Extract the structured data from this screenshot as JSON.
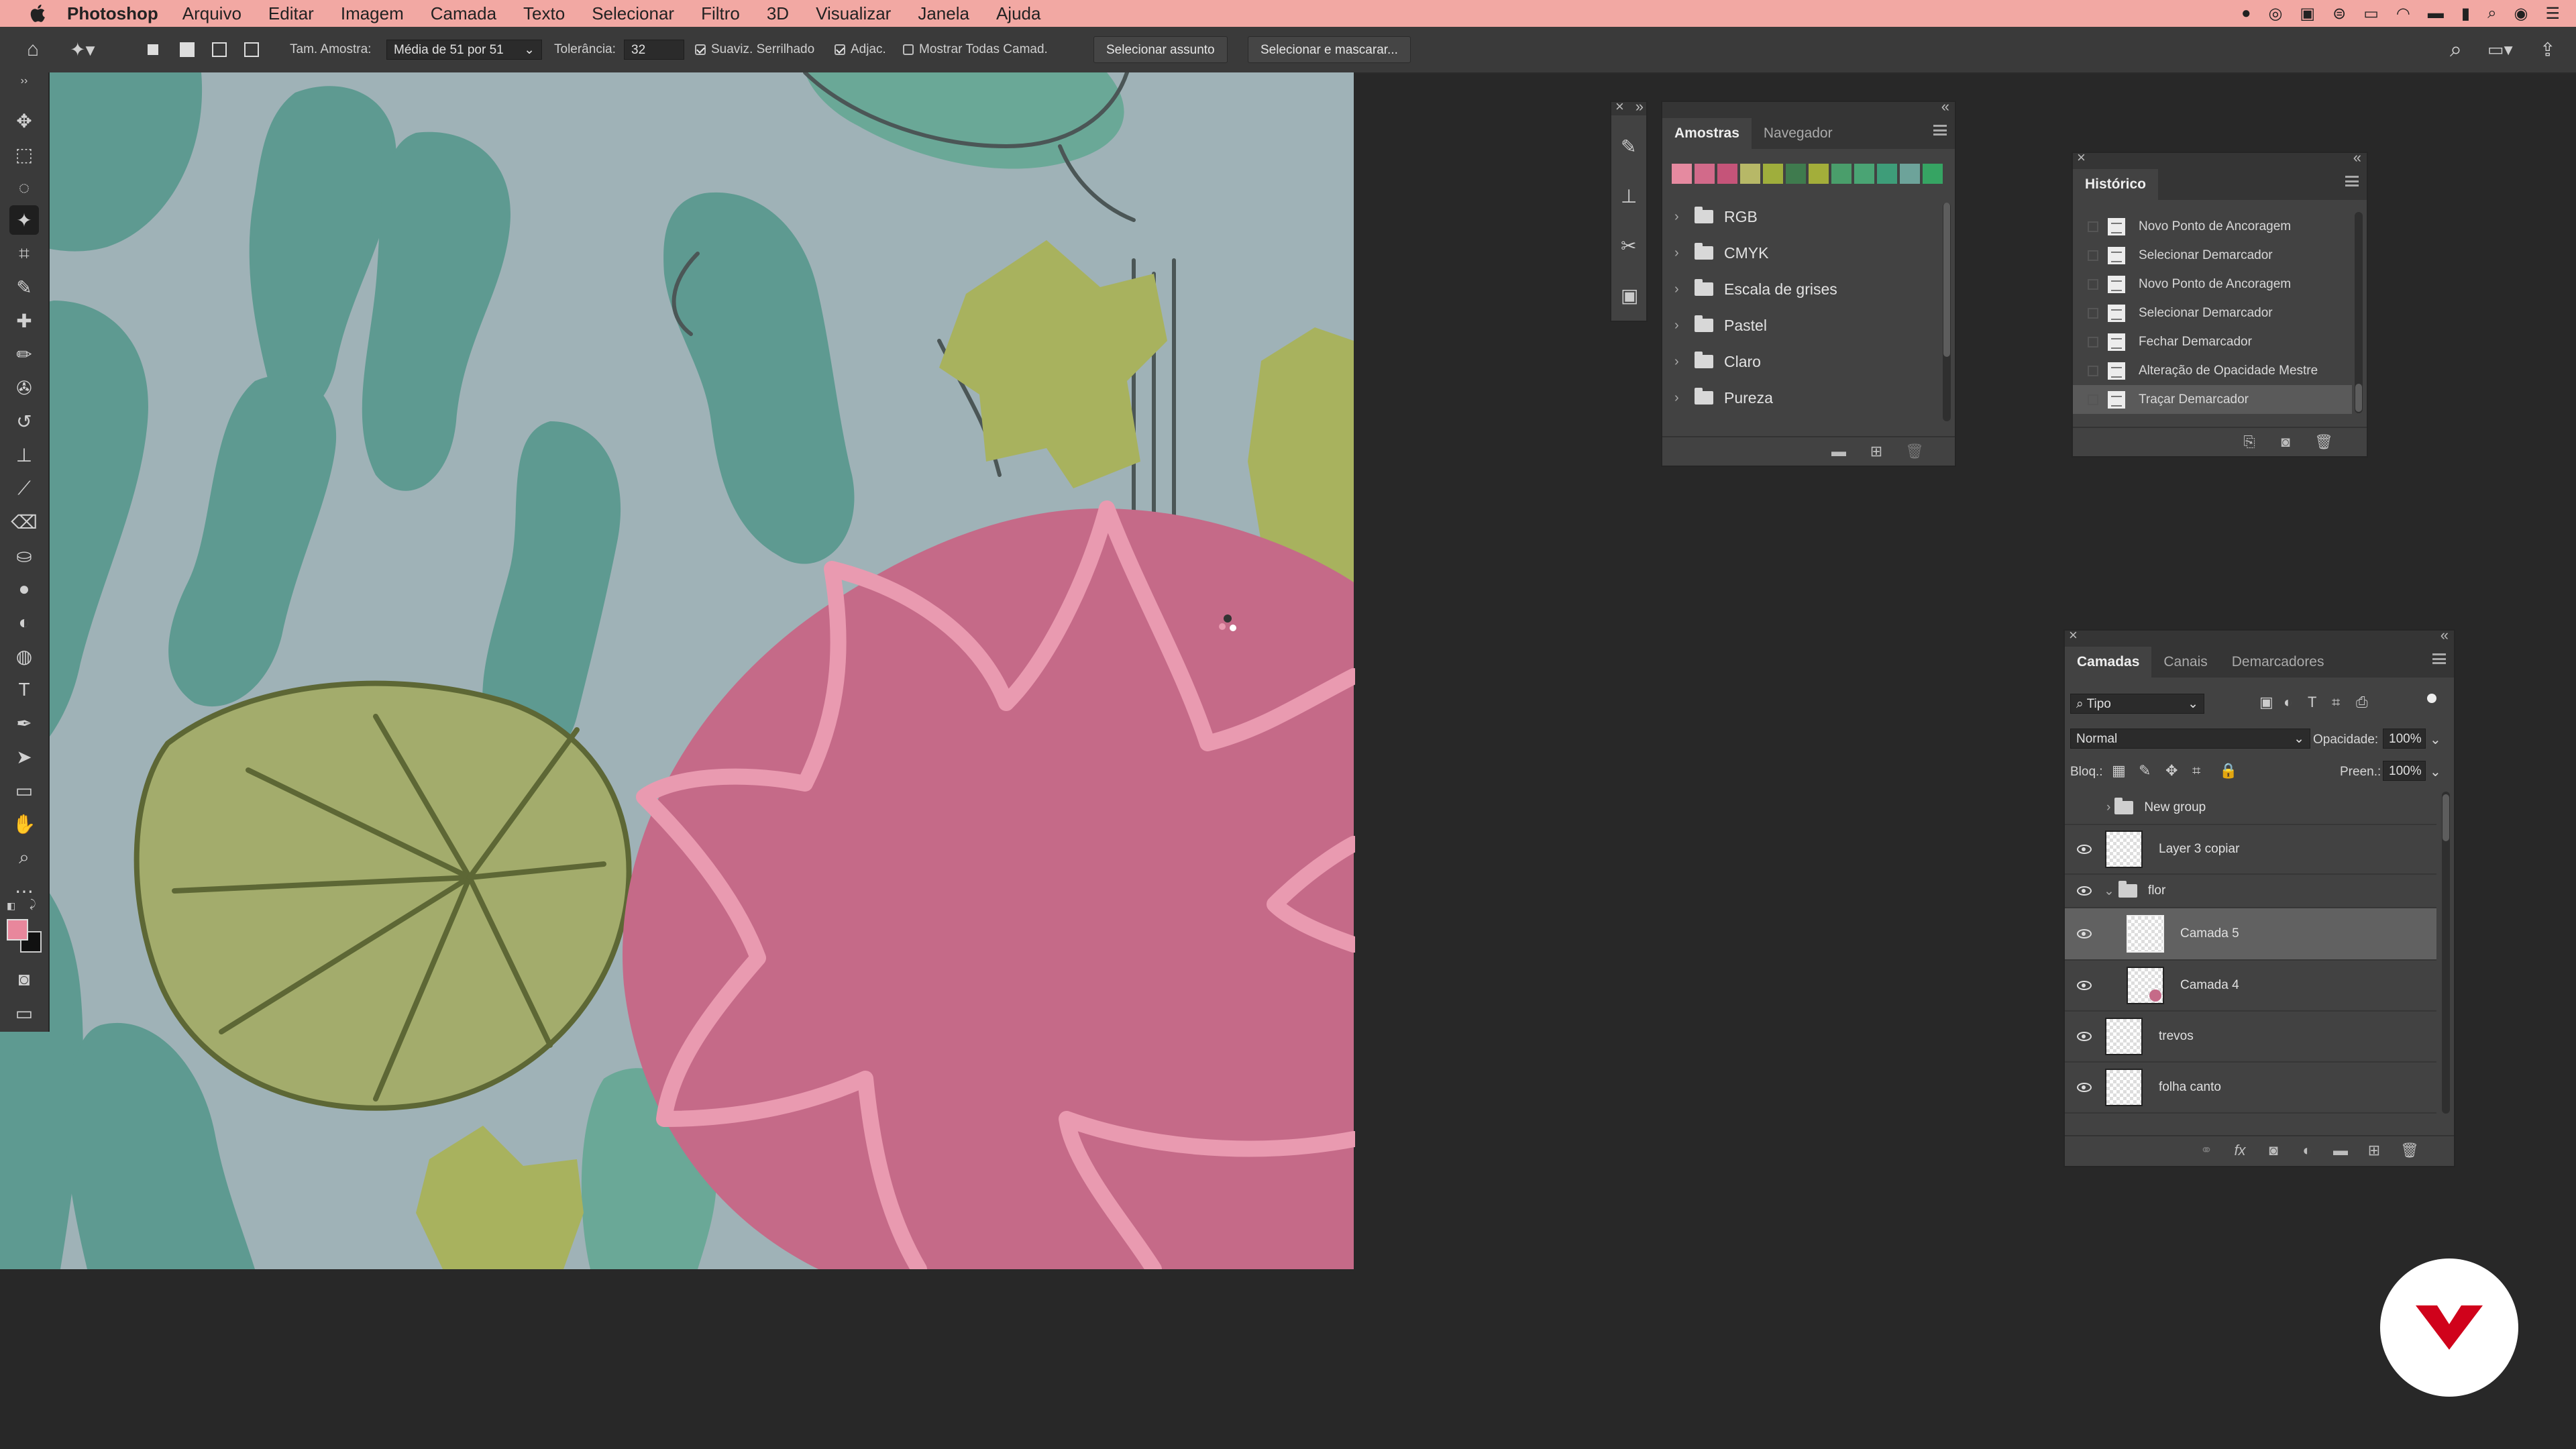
{
  "menubar": {
    "app": "Photoshop",
    "menus": [
      "Arquivo",
      "Editar",
      "Imagem",
      "Camada",
      "Texto",
      "Selecionar",
      "Filtro",
      "3D",
      "Visualizar",
      "Janela",
      "Ajuda"
    ]
  },
  "options": {
    "sample_size_label": "Tam. Amostra:",
    "sample_size_value": "Média de 51 por 51",
    "tolerance_label": "Tolerância:",
    "tolerance_value": "32",
    "antialias_label": "Suaviz. Serrilhado",
    "antialias_checked": true,
    "contiguous_label": "Adjac.",
    "contiguous_checked": true,
    "sample_all_label": "Mostrar Todas Camad.",
    "sample_all_checked": false,
    "select_subject": "Selecionar assunto",
    "select_mask": "Selecionar e mascarar..."
  },
  "colors": {
    "foreground": "#e8879c",
    "background": "#111111",
    "menubar_bg": "#f2a8a3"
  },
  "swatches_panel": {
    "tabs": [
      "Amostras",
      "Navegador"
    ],
    "active_tab": "Amostras",
    "swatches": [
      "#e58aa0",
      "#d26a8a",
      "#c55479",
      "#b7b867",
      "#9fae3c",
      "#3f7b4e",
      "#a3ae3a",
      "#4a9e6b",
      "#4aa474",
      "#3e9d79",
      "#6da39a",
      "#36a463"
    ],
    "folders": [
      "RGB",
      "CMYK",
      "Escala de grises",
      "Pastel",
      "Claro",
      "Pureza"
    ]
  },
  "history_panel": {
    "title": "Histórico",
    "items": [
      "Novo Ponto de Ancoragem",
      "Selecionar Demarcador",
      "Novo Ponto de Ancoragem",
      "Selecionar Demarcador",
      "Fechar Demarcador",
      "Alteração de Opacidade Mestre",
      "Traçar Demarcador"
    ],
    "selected_index": 6
  },
  "layers_panel": {
    "tabs": [
      "Camadas",
      "Canais",
      "Demarcadores"
    ],
    "active_tab": "Camadas",
    "filter": "Tipo",
    "blend_mode": "Normal",
    "opacity_label": "Opacidade:",
    "opacity_value": "100%",
    "lock_label": "Bloq.:",
    "fill_label": "Preen.:",
    "fill_value": "100%",
    "layers": [
      {
        "name": "New group",
        "type": "group",
        "collapsed": true,
        "visible": false
      },
      {
        "name": "Layer 3 copiar",
        "type": "layer",
        "visible": true
      },
      {
        "name": "flor",
        "type": "group",
        "collapsed": false,
        "visible": true
      },
      {
        "name": "Camada 5",
        "type": "layer",
        "visible": true,
        "selected": true
      },
      {
        "name": "Camada 4",
        "type": "layer",
        "visible": true
      },
      {
        "name": "trevos",
        "type": "layer",
        "visible": true
      },
      {
        "name": "folha canto",
        "type": "layer",
        "visible": true
      }
    ]
  }
}
